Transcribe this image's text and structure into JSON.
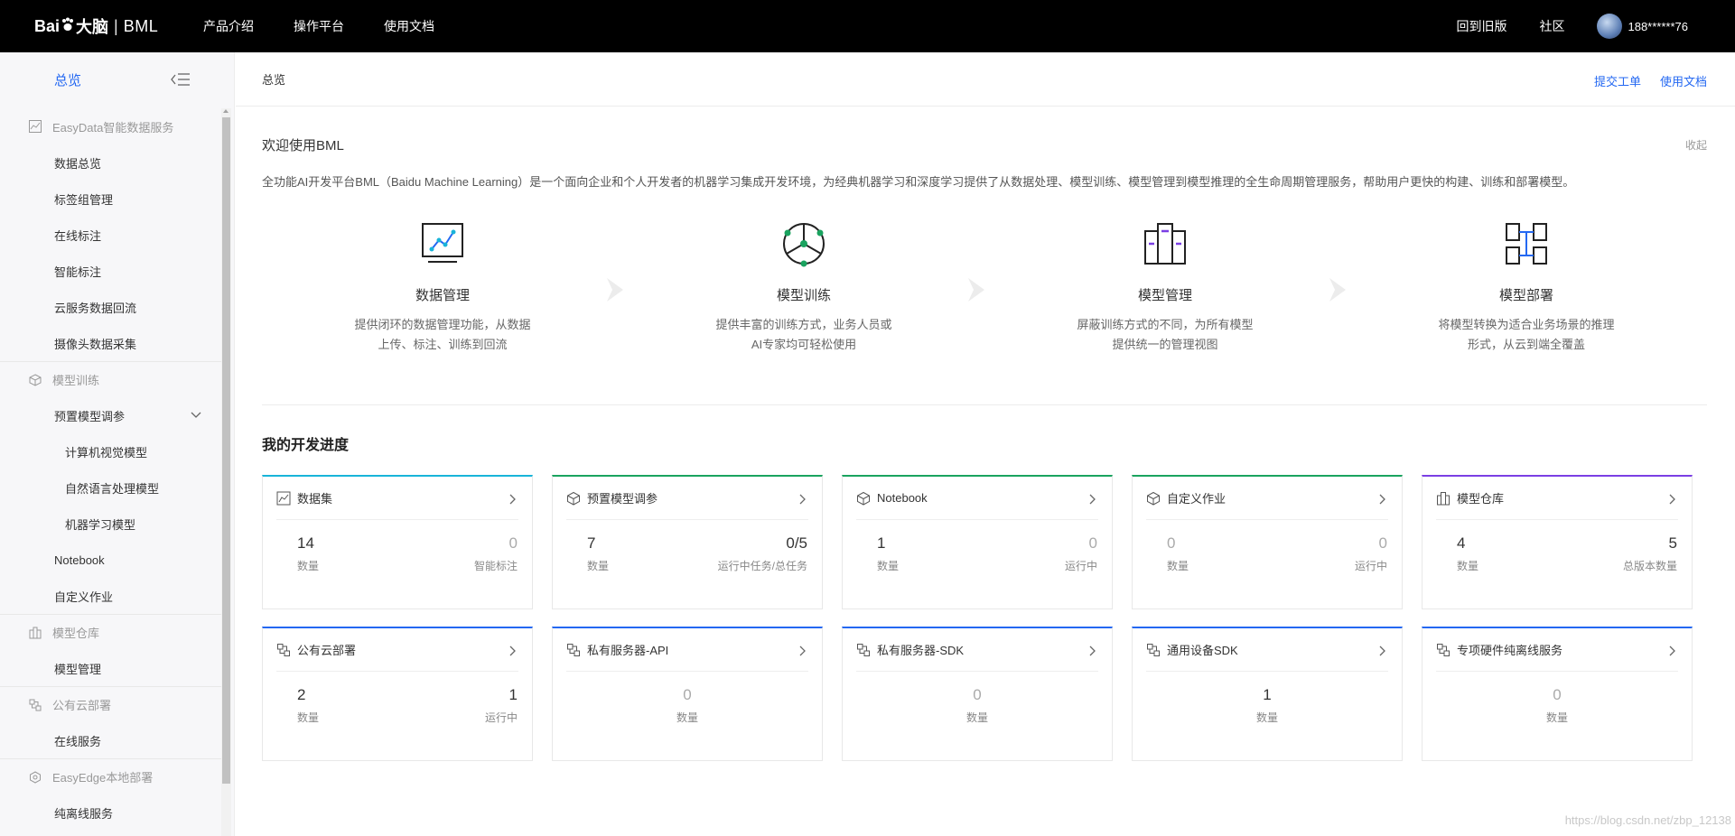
{
  "topbar": {
    "logo_brand": "Bai",
    "logo_paw": "du",
    "logo_cn": "大脑",
    "logo_sep": "|",
    "logo_product": "BML",
    "nav": [
      "产品介绍",
      "操作平台",
      "使用文档"
    ],
    "right_links": [
      "回到旧版",
      "社区"
    ],
    "user": "188******76"
  },
  "sidebar": {
    "header": "总览",
    "groups": {
      "easydata": "EasyData智能数据服务",
      "training": "模型训练",
      "repo": "模型仓库",
      "deploy": "公有云部署",
      "easyedge": "EasyEdge本地部署"
    },
    "items": {
      "data_overview": "数据总览",
      "label_group": "标签组管理",
      "online_label": "在线标注",
      "smart_label": "智能标注",
      "cloud_data": "云服务数据回流",
      "camera_data": "摄像头数据采集",
      "preset_tuning": "预置模型调参",
      "cv_model": "计算机视觉模型",
      "nlp_model": "自然语言处理模型",
      "ml_model": "机器学习模型",
      "notebook": "Notebook",
      "custom_job": "自定义作业",
      "model_mgmt": "模型管理",
      "online_service": "在线服务",
      "offline_service": "纯离线服务"
    }
  },
  "main": {
    "breadcrumb": "总览",
    "links": [
      "提交工单",
      "使用文档"
    ],
    "welcome": "欢迎使用BML",
    "collapse": "收起",
    "description": "全功能AI开发平台BML（Baidu Machine Learning）是一个面向企业和个人开发者的机器学习集成开发环境，为经典机器学习和深度学习提供了从数据处理、模型训练、模型管理到模型推理的全生命周期管理服务，帮助用户更快的构建、训练和部署模型。",
    "features": [
      {
        "title": "数据管理",
        "line1": "提供闭环的数据管理功能，从数据",
        "line2": "上传、标注、训练到回流"
      },
      {
        "title": "模型训练",
        "line1": "提供丰富的训练方式，业务人员或",
        "line2": "AI专家均可轻松使用"
      },
      {
        "title": "模型管理",
        "line1": "屏蔽训练方式的不同，为所有模型",
        "line2": "提供统一的管理视图"
      },
      {
        "title": "模型部署",
        "line1": "将模型转换为适合业务场景的推理",
        "line2": "形式，从云到端全覆盖"
      }
    ],
    "progress_title": "我的开发进度",
    "cards": [
      {
        "title": "数据集",
        "left_num": "14",
        "left_label": "数量",
        "right_num": "0",
        "right_label": "智能标注"
      },
      {
        "title": "预置模型调参",
        "left_num": "7",
        "left_label": "数量",
        "right_num": "0/5",
        "right_label": "运行中任务/总任务"
      },
      {
        "title": "Notebook",
        "left_num": "1",
        "left_label": "数量",
        "right_num": "0",
        "right_label": "运行中"
      },
      {
        "title": "自定义作业",
        "left_num": "0",
        "left_label": "数量",
        "right_num": "0",
        "right_label": "运行中"
      },
      {
        "title": "模型仓库",
        "left_num": "4",
        "left_label": "数量",
        "right_num": "5",
        "right_label": "总版本数量"
      },
      {
        "title": "公有云部署",
        "left_num": "2",
        "left_label": "数量",
        "right_num": "1",
        "right_label": "运行中"
      },
      {
        "title": "私有服务器-API",
        "center_num": "0",
        "center_label": "数量"
      },
      {
        "title": "私有服务器-SDK",
        "center_num": "0",
        "center_label": "数量"
      },
      {
        "title": "通用设备SDK",
        "center_num": "1",
        "center_label": "数量"
      },
      {
        "title": "专项硬件纯离线服务",
        "center_num": "0",
        "center_label": "数量"
      }
    ],
    "card_colors": {
      "data": "#18b4d9",
      "train": "#1aa35f",
      "repo": "#7b3fe4",
      "deploy": "#2468f2"
    }
  },
  "watermark": "https://blog.csdn.net/zbp_12138"
}
